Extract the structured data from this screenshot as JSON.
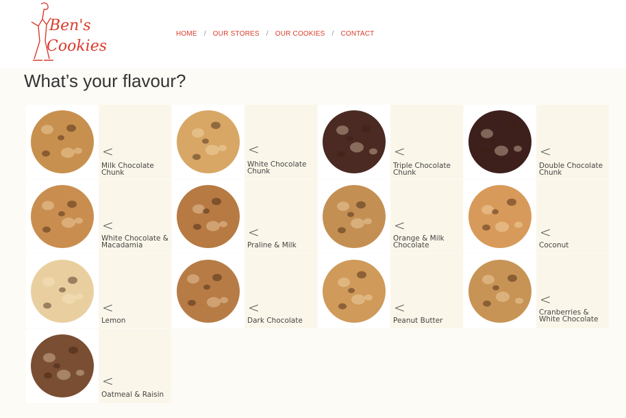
{
  "brand": {
    "logo_line1": "Ben's",
    "logo_line2": "Cookies"
  },
  "nav": {
    "items": [
      "HOME",
      "OUR STORES",
      "OUR COOKIES",
      "CONTACT"
    ],
    "separator": "/",
    "color": "#d93a2b"
  },
  "page_title": "What’s your flavour?",
  "cookies": [
    {
      "name": "Milk Chocolate Chunk",
      "color": "#c8904e",
      "icon": "cookie-image"
    },
    {
      "name": "White Chocolate Chunk",
      "color": "#d8a765",
      "icon": "cookie-image"
    },
    {
      "name": "Triple Chocolate Chunk",
      "color": "#4a2a22",
      "icon": "cookie-image"
    },
    {
      "name": "Double Chocolate Chunk",
      "color": "#3d1f1c",
      "icon": "cookie-image"
    },
    {
      "name": "White Chocolate & Macadamia",
      "color": "#c98e4f",
      "icon": "cookie-image"
    },
    {
      "name": "Praline & Milk",
      "color": "#b77a43",
      "icon": "cookie-image"
    },
    {
      "name": "Orange & Milk Chocolate",
      "color": "#c48f52",
      "icon": "cookie-image"
    },
    {
      "name": "Coconut",
      "color": "#d89a5a",
      "icon": "cookie-image"
    },
    {
      "name": "Lemon",
      "color": "#e9cfa0",
      "icon": "cookie-image"
    },
    {
      "name": "Dark Chocolate",
      "color": "#b77c46",
      "icon": "cookie-image"
    },
    {
      "name": "Peanut Butter",
      "color": "#cf9a5a",
      "icon": "cookie-image"
    },
    {
      "name": "Cranberries & White Chocolate",
      "color": "#c89456",
      "icon": "cookie-image"
    },
    {
      "name": "Oatmeal & Raisin",
      "color": "#7a4e33",
      "icon": "cookie-image"
    }
  ],
  "arrow_glyph": "<"
}
